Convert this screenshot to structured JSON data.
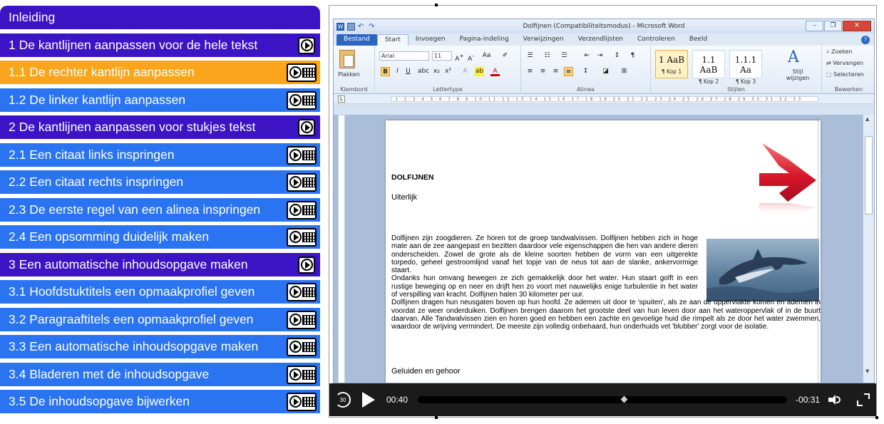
{
  "nav": {
    "items": [
      {
        "label": "Inleiding",
        "kind": "intro"
      },
      {
        "label": "1 De kantlijnen aanpassen voor de hele tekst",
        "kind": "chapter"
      },
      {
        "label": "1.1 De rechter kantlijn aanpassen",
        "kind": "lesson",
        "active": true
      },
      {
        "label": "1.2 De linker kantlijn aanpassen",
        "kind": "lesson"
      },
      {
        "label": "2 De kantlijnen aanpassen voor stukjes tekst",
        "kind": "chapter"
      },
      {
        "label": "2.1 Een citaat links inspringen",
        "kind": "lesson"
      },
      {
        "label": "2.2 Een citaat rechts inspringen",
        "kind": "lesson"
      },
      {
        "label": "2.3 De eerste regel van een alinea inspringen",
        "kind": "lesson"
      },
      {
        "label": "2.4 Een opsomming duidelijk maken",
        "kind": "lesson"
      },
      {
        "label": "3 Een automatische inhoudsopgave maken",
        "kind": "chapter"
      },
      {
        "label": "3.1 Hoofdstuktitels een opmaakprofiel geven",
        "kind": "lesson"
      },
      {
        "label": "3.2 Paragraaftitels een opmaakprofiel geven",
        "kind": "lesson"
      },
      {
        "label": "3.3 Een automatische inhoudsopgave maken",
        "kind": "lesson"
      },
      {
        "label": "3.4 Bladeren met de inhoudsopgave",
        "kind": "lesson"
      },
      {
        "label": "3.5 De inhoudsopgave bijwerken",
        "kind": "lesson"
      }
    ],
    "colors": {
      "chapter": "#3d14c4",
      "lesson": "#2a74f2",
      "active": "#fba51c"
    }
  },
  "word": {
    "title": "Dolfijnen (Compatibiliteitsmodus) - Microsoft Word",
    "tabs": [
      "Bestand",
      "Start",
      "Invoegen",
      "Pagina-indeling",
      "Verwijzingen",
      "Verzendlijsten",
      "Controleren",
      "Beeld"
    ],
    "active_tab": "Start",
    "ribbon": {
      "paste": "Plakken",
      "clipboard_group": "Klembord",
      "font_name": "Arial",
      "font_size": "11",
      "font_group": "Lettertype",
      "paragraph_group": "Alinea",
      "styles_group": "Stijlen",
      "styles": [
        {
          "sample": "1 AaB",
          "name": "¶ Kop 1"
        },
        {
          "sample": "1.1 AaB",
          "name": "¶ Kop 2"
        },
        {
          "sample": "1.1.1 Aa",
          "name": "¶ Kop 3"
        }
      ],
      "change_styles": "Stijl wijzigen",
      "edit_group": "Bewerken",
      "find": "Zoeken",
      "replace": "Vervangen",
      "select": "Selecteren"
    },
    "document": {
      "title": "DOLFIJNEN",
      "subtitle": "Uiterlijk",
      "paragraph1": "Dolfijnen zijn zoogdieren. Ze horen tot de groep tandwalvissen. Dolfijnen hebben zich in hoge mate aan de zee aangepast en bezitten daardoor vele eigenschappen die hen van andere dieren onderscheiden. Zowel de grote als de kleine soorten hebben de vorm van een uitgerekte torpedo, geheel gestroomlijnd vanaf het topje van de neus tot aan de slanke, ankervormige staart.",
      "paragraph2": "Ondanks hun omvang bewegen ze zich gemakkelijk door het water. Hun staart golft in een rustige beweging op en neer en drijft hen zo voort met nauwelijks enige turbulentie in het water of verspilling van kracht. Dolfijnen halen 30 kilometer per uur.",
      "paragraph3": "Dolfijnen dragen hun neusgaten boven op hun hoofd. Ze ademen uit door te 'spuiten', als ze aan de oppervlakte komen en ademen in voordat ze weer onderduiken. Dolfijnen brengen daarom het grootste deel van hun leven door aan het wateroppervlak of in de buurt daarvan. Alle Tandwalvissen zien en horen goed en hebben een zachte en gevoelige huid die rimpelt als ze door het water zwemmen, waardoor de wrijving vermindert. De meeste zijn volledig onbehaard, hun onderhuids vet 'blubber' zorgt voor de isolatie.",
      "subtitle2": "Geluiden en gehoor"
    }
  },
  "player": {
    "rewind_label": "30",
    "time_current": "00:40",
    "time_remaining": "-00:31",
    "progress": 0.56
  }
}
